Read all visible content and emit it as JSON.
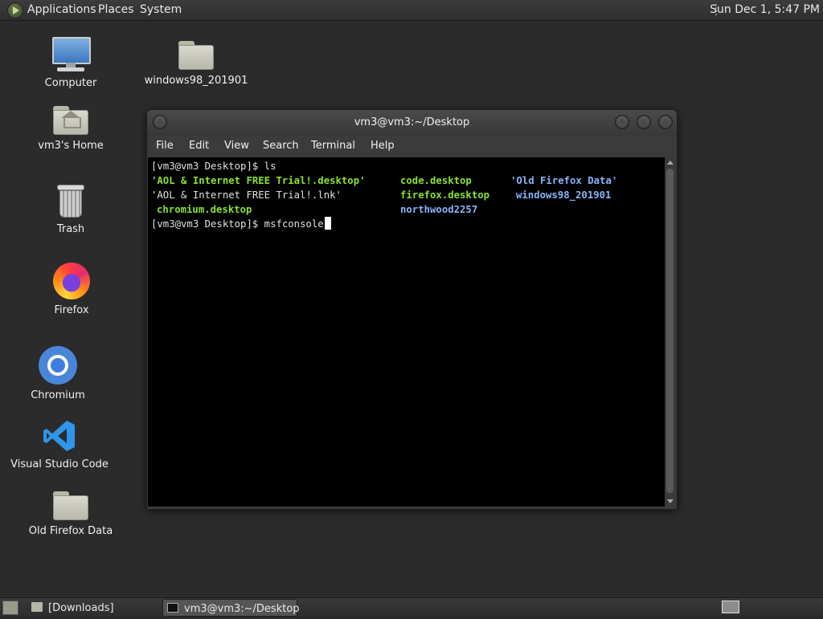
{
  "top_panel": {
    "menus": [
      "Applications",
      "Places",
      "System"
    ],
    "clock": "Sun Dec 1,  5:47 PM"
  },
  "desktop": {
    "icons": [
      {
        "label": "Computer",
        "icon": "computer-icon"
      },
      {
        "label": "vm3's Home",
        "icon": "home-folder-icon"
      },
      {
        "label": "Trash",
        "icon": "trash-icon"
      },
      {
        "label": "Firefox",
        "icon": "firefox-icon"
      },
      {
        "label": "Chromium",
        "icon": "chromium-icon"
      },
      {
        "label": "Visual Studio Code",
        "icon": "vscode-icon"
      },
      {
        "label": "Old Firefox Data",
        "icon": "folder-icon"
      },
      {
        "label": "windows98_201901",
        "icon": "folder-icon"
      }
    ]
  },
  "terminal": {
    "title": "vm3@vm3:~/Desktop",
    "menu": [
      "File",
      "Edit",
      "View",
      "Search",
      "Terminal",
      "Help"
    ],
    "lines": {
      "prompt1": "[vm3@vm3 Desktop]$ ls",
      "r1c1": "'AOL & Internet FREE Trial!.desktop'",
      "r1c2": "code.desktop",
      "r1c3": "'Old Firefox Data'",
      "r2c1": "'AOL & Internet FREE Trial!.lnk'",
      "r2c2": "firefox.desktop",
      "r2c3": "windows98_201901",
      "r3c1": "chromium.desktop",
      "r3c2": "northwood2257",
      "prompt2": "[vm3@vm3 Desktop]$ msfconsole"
    },
    "colors": {
      "executable": "#8ae234",
      "directory": "#8ab4f8",
      "background": "#000000"
    }
  },
  "bottom_panel": {
    "tasks": [
      "[Downloads]",
      "vm3@vm3:~/Desktop"
    ]
  }
}
